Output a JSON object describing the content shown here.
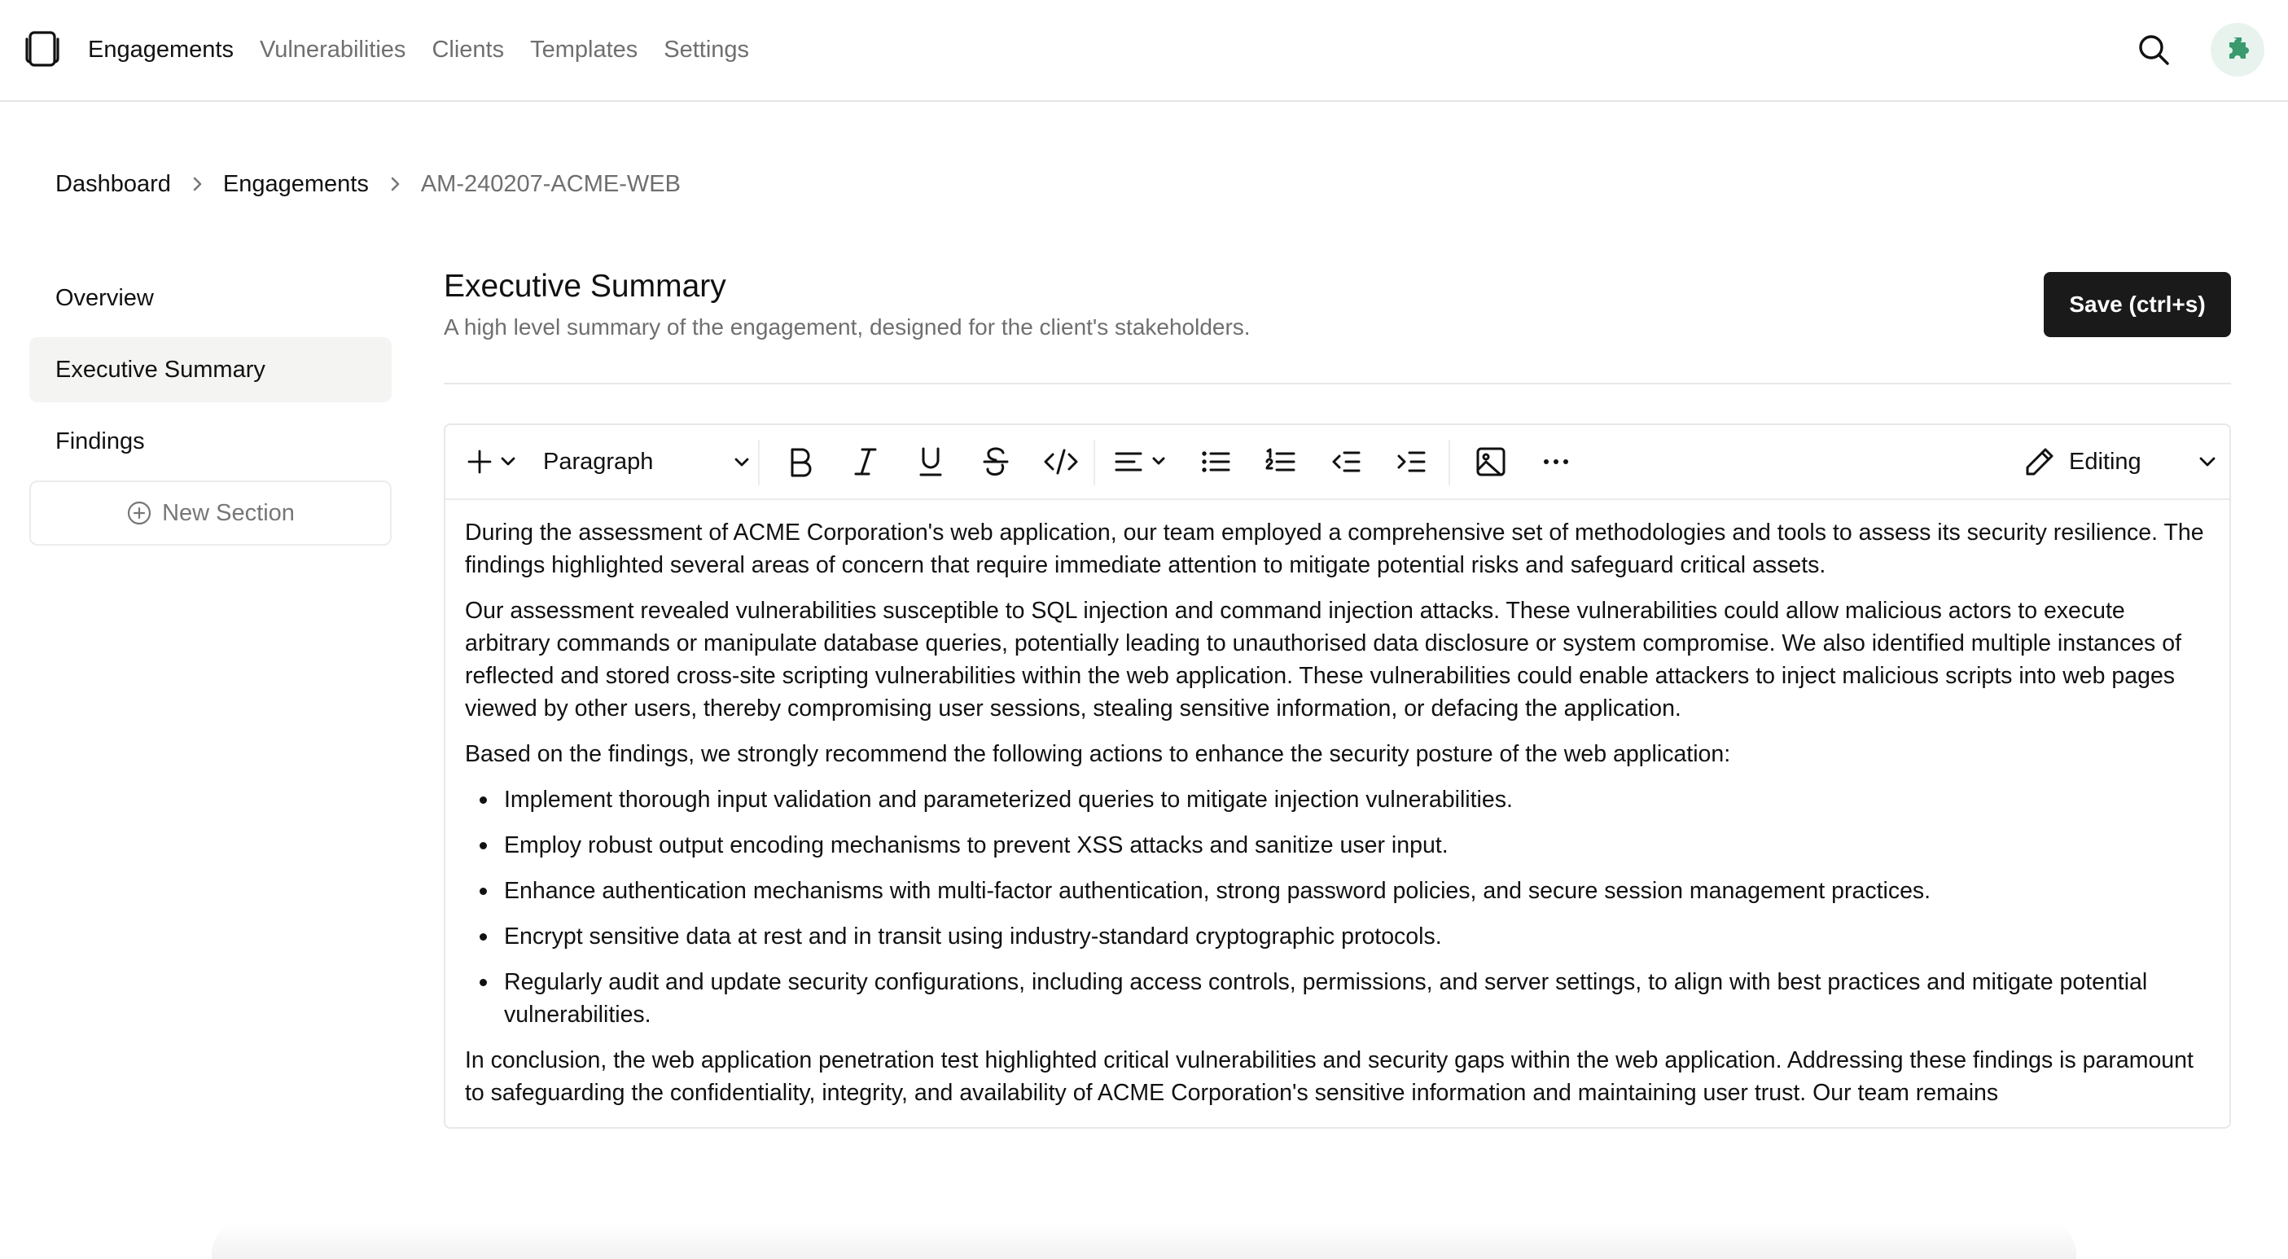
{
  "nav": {
    "links": [
      "Engagements",
      "Vulnerabilities",
      "Clients",
      "Templates",
      "Settings"
    ],
    "active": "Engagements"
  },
  "breadcrumb": [
    "Dashboard",
    "Engagements",
    "AM-240207-ACME-WEB"
  ],
  "sections": {
    "items": [
      "Overview",
      "Executive Summary",
      "Findings"
    ],
    "active": "Executive Summary",
    "new_section_label": "New Section"
  },
  "header": {
    "title": "Executive Summary",
    "description": "A high level summary of the engagement, designed for the client's stakeholders.",
    "save_label": "Save (ctrl+s)"
  },
  "toolbar": {
    "block_type": "Paragraph",
    "mode": "Editing",
    "icons": [
      "plus-icon",
      "bold-icon",
      "italic-icon",
      "underline-icon",
      "strikethrough-icon",
      "code-icon",
      "align-icon",
      "bullet-list-icon",
      "numbered-list-icon",
      "outdent-icon",
      "indent-icon",
      "image-icon",
      "more-icon",
      "pencil-icon"
    ]
  },
  "document": {
    "p1": "During the assessment of ACME Corporation's web application, our team employed a comprehensive set of methodologies and tools to assess its security resilience. The findings highlighted several areas of concern that require immediate attention to mitigate potential risks and safeguard critical assets.",
    "p2": "Our assessment revealed vulnerabilities susceptible to SQL injection and command injection attacks. These vulnerabilities could allow malicious actors to execute arbitrary commands or manipulate database queries, potentially leading to unauthorised data disclosure or system compromise. We also identified multiple instances of reflected and stored cross-site scripting vulnerabilities within the web application. These vulnerabilities could enable attackers to inject malicious scripts into web pages viewed by other users, thereby compromising user sessions, stealing sensitive information, or defacing the application.",
    "p3": "Based on the findings, we strongly recommend the following actions to enhance the security posture of the web application:",
    "bullets": [
      "Implement thorough input validation and parameterized queries to mitigate injection vulnerabilities.",
      "Employ robust output encoding mechanisms to prevent XSS attacks and sanitize user input.",
      "Enhance authentication mechanisms with multi-factor authentication, strong password policies, and secure session management practices.",
      "Encrypt sensitive data at rest and in transit using industry-standard cryptographic protocols.",
      "Regularly audit and update security configurations, including access controls, permissions, and server settings, to align with best practices and mitigate potential vulnerabilities."
    ],
    "p4": "In conclusion, the web application penetration test highlighted critical vulnerabilities and security gaps within the web application. Addressing these findings is paramount to safeguarding the confidentiality, integrity, and availability of ACME Corporation's sensitive information and maintaining user trust. Our team remains"
  },
  "colors": {
    "accent": "#1a1a1a",
    "muted_text": "#6f6f6f",
    "avatar_bg": "#e8f3ee",
    "avatar_fg": "#3a9a6e"
  }
}
